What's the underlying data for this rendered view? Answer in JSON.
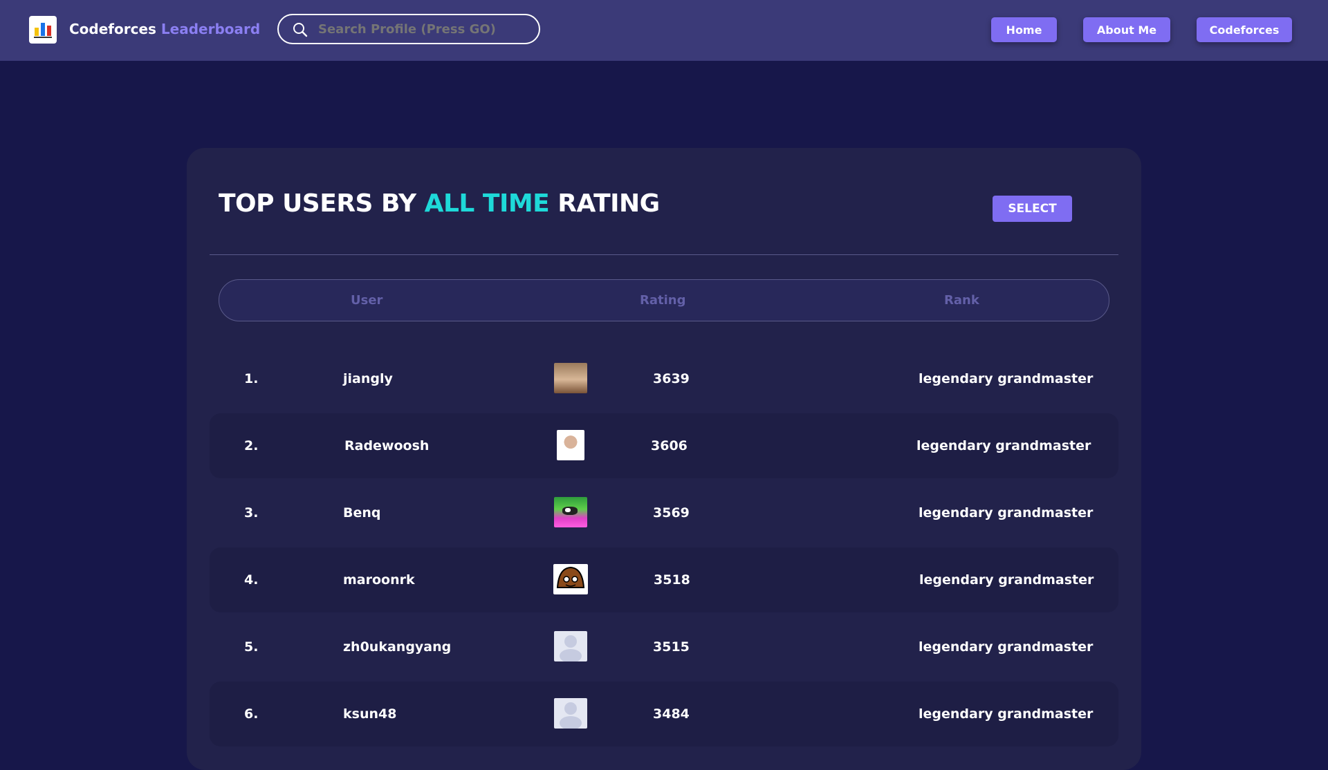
{
  "nav": {
    "brand_main": "Codeforces",
    "brand_accent": "Leaderboard",
    "search_placeholder": "Search Profile (Press GO)",
    "links": [
      "Home",
      "About Me",
      "Codeforces"
    ]
  },
  "board": {
    "title_pre": "TOP USERS BY",
    "title_highlight": "ALL TIME",
    "title_post": "RATING",
    "select_label": "SELECT",
    "columns": [
      "User",
      "Rating",
      "Rank"
    ],
    "rows": [
      {
        "num": "1.",
        "user": "jiangly",
        "rating": "3639",
        "rank": "legendary grandmaster"
      },
      {
        "num": "2.",
        "user": "Radewoosh",
        "rating": "3606",
        "rank": "legendary grandmaster"
      },
      {
        "num": "3.",
        "user": "Benq",
        "rating": "3569",
        "rank": "legendary grandmaster"
      },
      {
        "num": "4.",
        "user": "maroonrk",
        "rating": "3518",
        "rank": "legendary grandmaster"
      },
      {
        "num": "5.",
        "user": "zh0ukangyang",
        "rating": "3515",
        "rank": "legendary grandmaster"
      },
      {
        "num": "6.",
        "user": "ksun48",
        "rating": "3484",
        "rank": "legendary grandmaster"
      }
    ]
  },
  "colors": {
    "background": "#17174a",
    "navbar": "#3b3a78",
    "accent": "#7f6df2",
    "highlight": "#1ed9d9",
    "card": "#22224b"
  }
}
